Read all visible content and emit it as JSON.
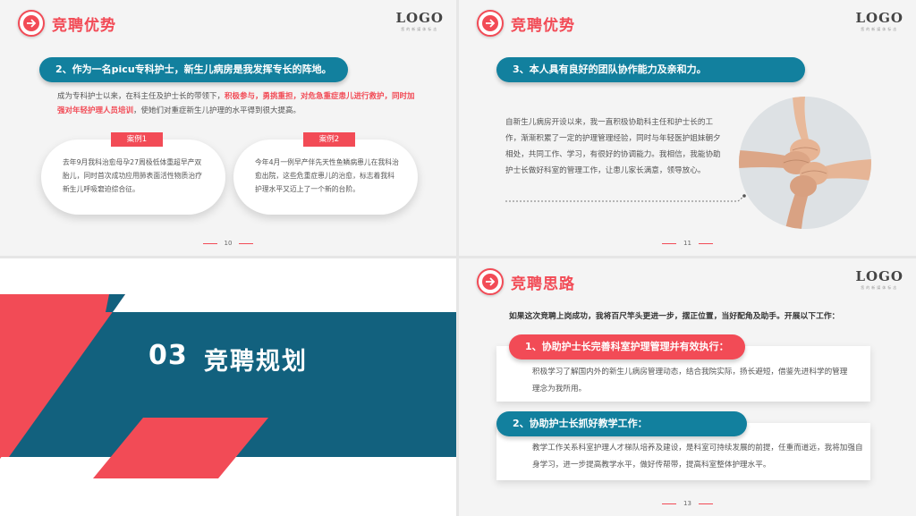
{
  "logo": {
    "text": "LOGO",
    "sub": "您的新媒体标志"
  },
  "slide1": {
    "title": "竞聘优势",
    "pill": "2、作为一名picu专科护士，新生儿病房是我发挥专长的阵地。",
    "para_a": "成为专科护士以来，在科主任及护士长的带领下，",
    "para_hl": "积极参与，勇挑重担，对危急重症患儿进行救护，同时加强对年轻护理人员培训",
    "para_b": "，使她们对重症新生儿护理的水平得到很大提高。",
    "case1_tag": "案例1",
    "case1_text": "去年9月我科治愈母孕27周极低体重超早产双胎儿，同时首次成功应用肺表面活性物质治疗新生儿呼吸窘迫综合征。",
    "case2_tag": "案例2",
    "case2_text": "今年4月一例早产伴先天性鱼鳞病患儿在我科治愈出院，这些危重症患儿的治愈，标志着我科护理水平又迈上了一个新的台阶。",
    "page": "10"
  },
  "slide2": {
    "title": "竞聘优势",
    "pill": "3、本人具有良好的团队协作能力及亲和力。",
    "para": "自新生儿病房开设以来，我一直积极协助科主任和护士长的工作，渐渐积累了一定的护理管理经验，同时与年轻医护姐妹朝夕相处，共同工作、学习，有很好的协调能力。我相信，我能协助护士长做好科室的管理工作，让患儿家长满意，领导放心。",
    "page": "11"
  },
  "slide3": {
    "number": "03",
    "title": "竞聘规划",
    "colors": {
      "red": "#f24b56",
      "blue": "#12617e"
    }
  },
  "slide4": {
    "title": "竞聘思路",
    "intro": "如果这次竞聘上岗成功，我将百尺竿头更进一步，摆正位置，当好配角及助手。开展以下工作：",
    "item1_pill": "1、协助护士长完善科室护理管理并有效执行：",
    "item1_text": "积极学习了解国内外的新生儿病房管理动态，结合我院实际，扬长避短，借鉴先进科学的管理理念为我所用。",
    "item2_pill": "2、协助护士长抓好教学工作：",
    "item2_text": "教学工作关系科室护理人才梯队培养及建设，是科室可持续发展的前提，任重而道远，我将加强自身学习，进一步提高教学水平，做好传帮带，提高科室整体护理水平。",
    "page": "13"
  }
}
